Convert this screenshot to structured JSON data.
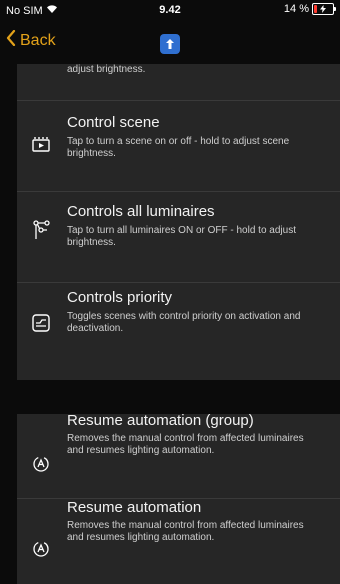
{
  "status_bar": {
    "carrier": "No SIM",
    "time": "9.42",
    "battery": "14 %"
  },
  "nav": {
    "back_label": "Back"
  },
  "items_top": [
    {
      "title": "",
      "description": "adjust brightness."
    },
    {
      "title": "Control scene",
      "description": "Tap to turn a scene on or off - hold to adjust scene brightness.",
      "icon": "scene-icon"
    },
    {
      "title": "Controls all luminaires",
      "description": "Tap to turn all luminaires ON or OFF - hold to adjust brightness.",
      "icon": "luminaires-icon"
    },
    {
      "title": "Controls priority",
      "description": "Toggles scenes with control priority on activation and deactivation.",
      "icon": "priority-icon"
    }
  ],
  "items_bottom": [
    {
      "title": "Resume automation (group)",
      "description": "Removes the manual control from affected luminaires and resumes lighting automation.",
      "icon": "automation-icon"
    },
    {
      "title": "Resume automation",
      "description": "Removes the manual control from affected luminaires and resumes lighting automation.",
      "icon": "automation-icon"
    }
  ],
  "colors": {
    "accent": "#e3a21a",
    "cell_bg": "#262626",
    "page_bg": "#0b0b0b",
    "logo": "#2f6fd0"
  }
}
